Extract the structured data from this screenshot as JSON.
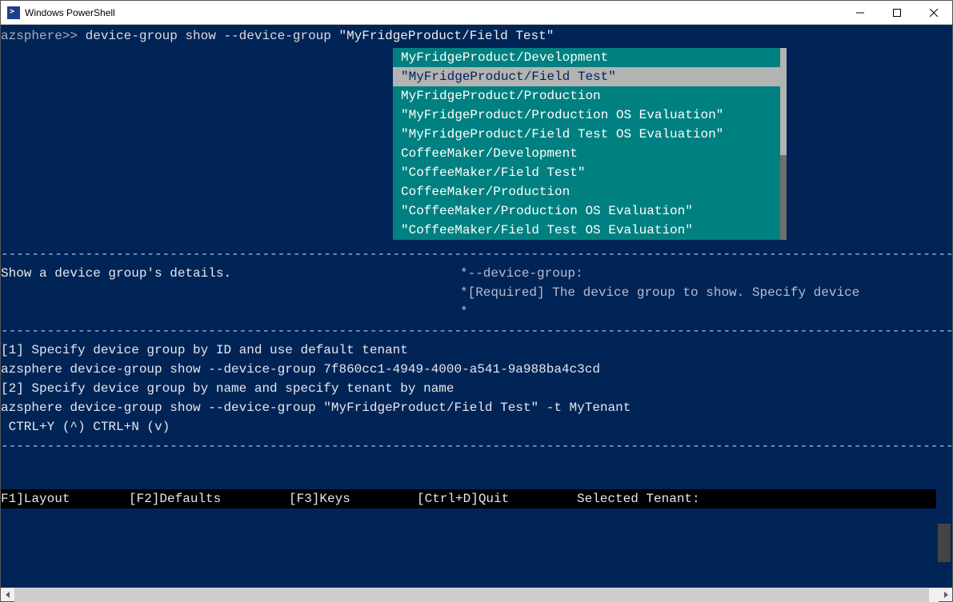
{
  "window": {
    "title": "Windows PowerShell"
  },
  "prompt": "azsphere>> ",
  "command_text": "device-group show --device-group ",
  "command_arg": "\"MyFridgeProduct/Field Test\"",
  "dropdown": {
    "selected_index": 1,
    "items": [
      "MyFridgeProduct/Development",
      "\"MyFridgeProduct/Field Test\"",
      "MyFridgeProduct/Production",
      "\"MyFridgeProduct/Production OS Evaluation\"",
      "\"MyFridgeProduct/Field Test OS Evaluation\"",
      "CoffeeMaker/Development",
      "\"CoffeeMaker/Field Test\"",
      "CoffeeMaker/Production",
      "\"CoffeeMaker/Production OS Evaluation\"",
      "\"CoffeeMaker/Field Test OS Evaluation\""
    ]
  },
  "help": {
    "summary": "Show a device group's details.",
    "param_header": "*--device-group:",
    "param_desc": "*[Required] The device group to show. Specify device",
    "param_cont": "*"
  },
  "examples": {
    "line1": "[1] Specify device group by ID and use default tenant",
    "line2": "azsphere device-group show --device-group 7f860cc1-4949-4000-a541-9a988ba4c3cd",
    "line3": "[2] Specify device group by name and specify tenant by name",
    "line4": "azsphere device-group show --device-group \"MyFridgeProduct/Field Test\" -t MyTenant",
    "line5": " CTRL+Y (^) CTRL+N (v)"
  },
  "statusbar": {
    "f1": "F1]Layout",
    "f2": "[F2]Defaults",
    "f3": "[F3]Keys",
    "quit": "[Ctrl+D]Quit",
    "tenant": "Selected Tenant:"
  },
  "dashes": "------------------------------------------------------------------------------------------------------------------------------------------------------",
  "colors": {
    "terminal_bg": "#012456",
    "dropdown_bg": "#008080",
    "dropdown_sel_bg": "#b3b3b3"
  }
}
